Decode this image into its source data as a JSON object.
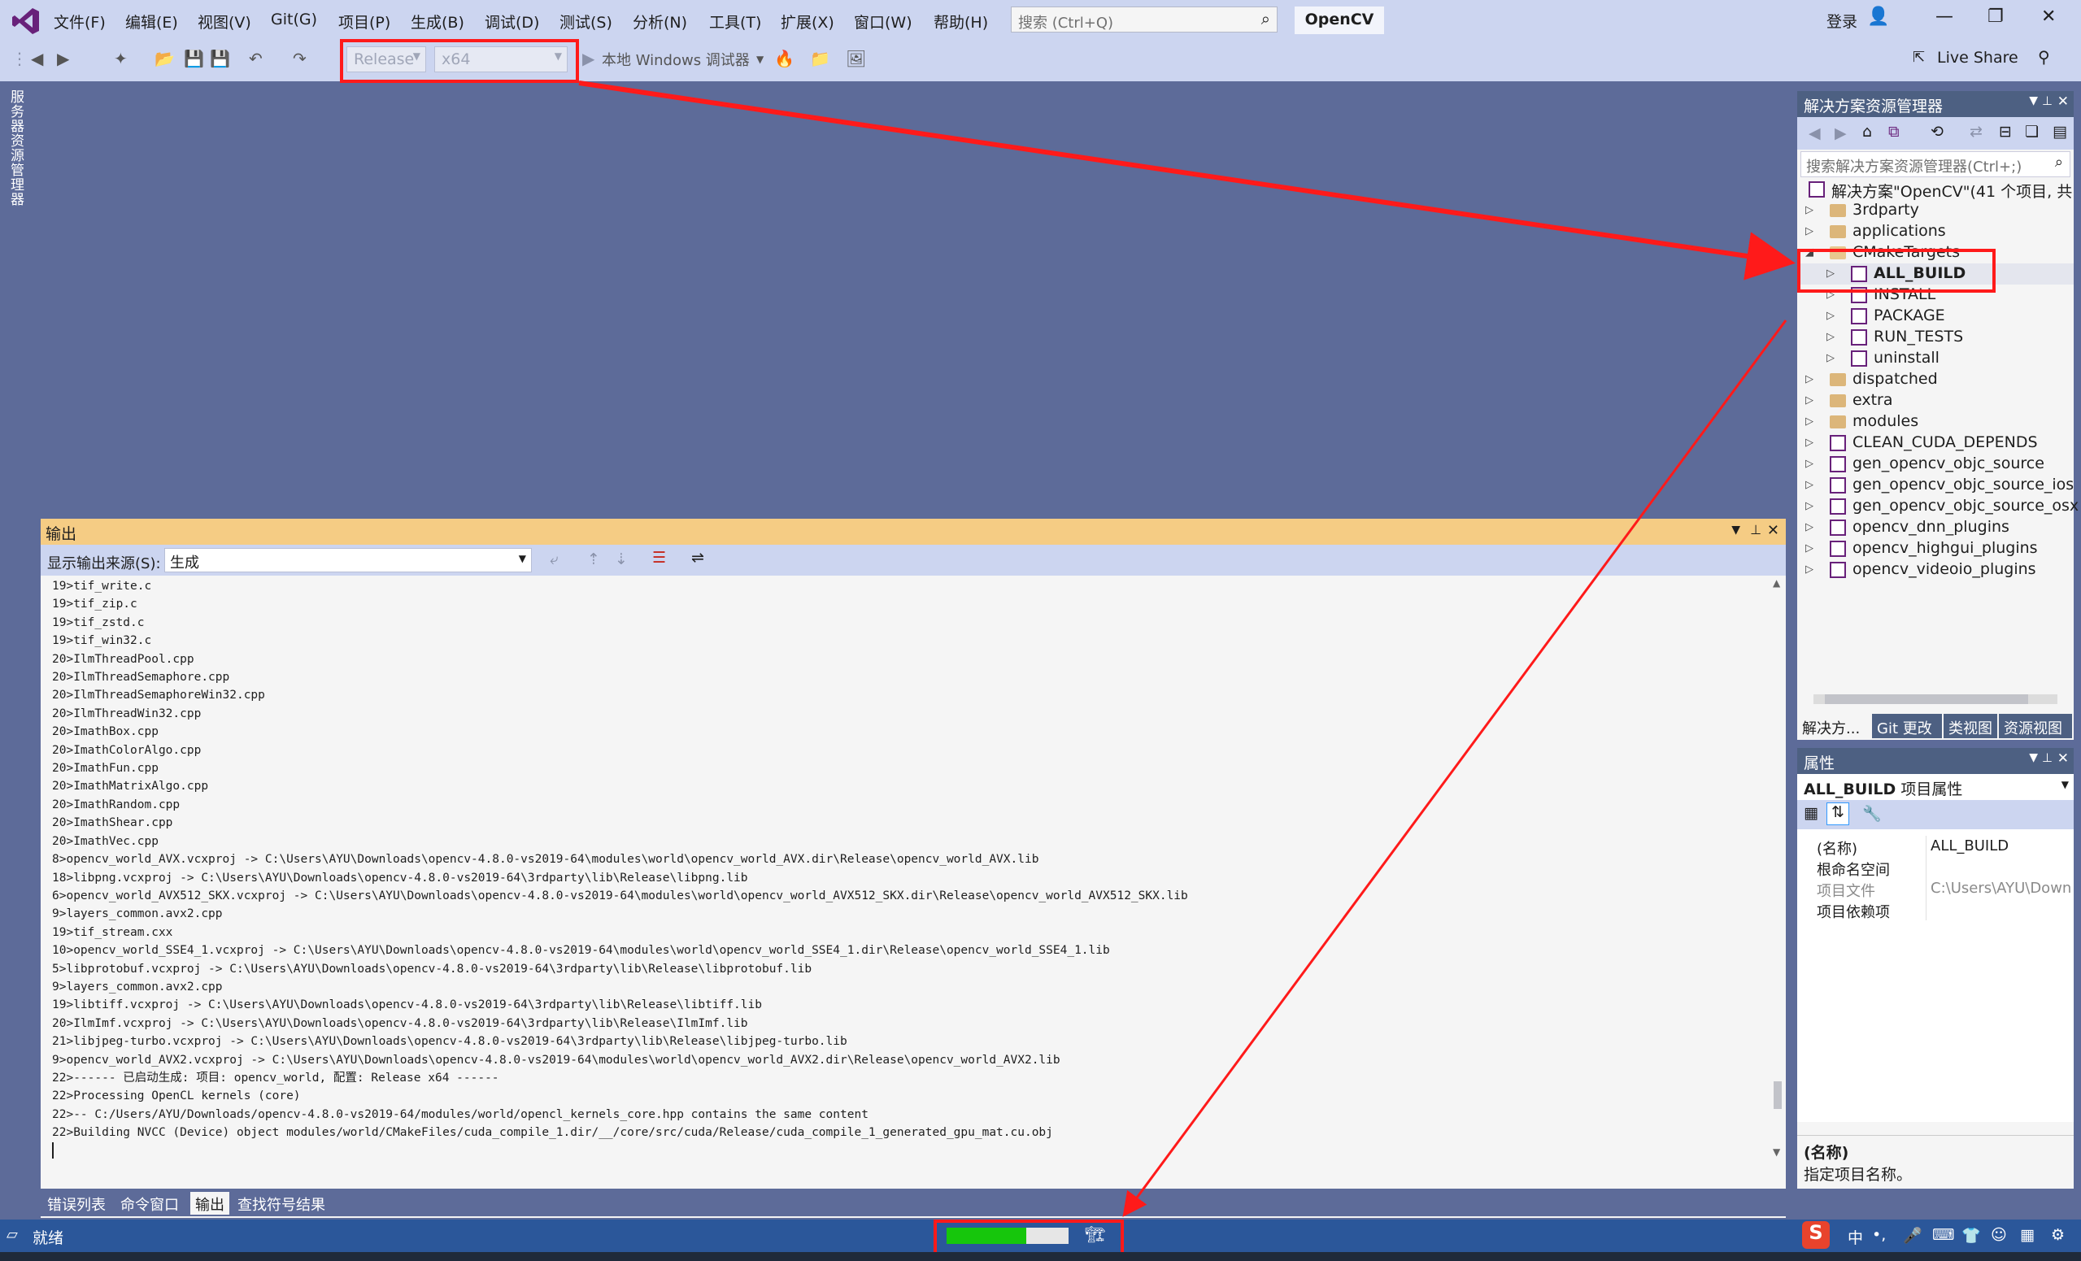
{
  "menu": [
    "文件(F)",
    "编辑(E)",
    "视图(V)",
    "Git(G)",
    "项目(P)",
    "生成(B)",
    "调试(D)",
    "测试(S)",
    "分析(N)",
    "工具(T)",
    "扩展(X)",
    "窗口(W)",
    "帮助(H)"
  ],
  "search": {
    "placeholder": "搜索 (Ctrl+Q)"
  },
  "app_name": "OpenCV",
  "login": "登录",
  "live_share": "Live Share",
  "toolbar": {
    "config": "Release",
    "platform": "x64",
    "debugger": "本地 Windows 调试器"
  },
  "left_strip": "服务器资源管理器",
  "solution_explorer": {
    "title": "解决方案资源管理器",
    "search_placeholder": "搜索解决方案资源管理器(Ctrl+;)",
    "items": [
      {
        "label": "解决方案\"OpenCV\"(41 个项目, 共",
        "kind": "solution"
      },
      {
        "label": "3rdparty",
        "kind": "folder"
      },
      {
        "label": "applications",
        "kind": "folder"
      },
      {
        "label": "CMakeTargets",
        "kind": "folder-open"
      },
      {
        "label": "ALL_BUILD",
        "kind": "project"
      },
      {
        "label": "INSTALL",
        "kind": "project"
      },
      {
        "label": "PACKAGE",
        "kind": "project"
      },
      {
        "label": "RUN_TESTS",
        "kind": "project"
      },
      {
        "label": "uninstall",
        "kind": "project"
      },
      {
        "label": "dispatched",
        "kind": "folder"
      },
      {
        "label": "extra",
        "kind": "folder"
      },
      {
        "label": "modules",
        "kind": "folder"
      },
      {
        "label": "CLEAN_CUDA_DEPENDS",
        "kind": "project"
      },
      {
        "label": "gen_opencv_objc_source",
        "kind": "project"
      },
      {
        "label": "gen_opencv_objc_source_ios",
        "kind": "project"
      },
      {
        "label": "gen_opencv_objc_source_osx",
        "kind": "project"
      },
      {
        "label": "opencv_dnn_plugins",
        "kind": "project"
      },
      {
        "label": "opencv_highgui_plugins",
        "kind": "project"
      },
      {
        "label": "opencv_videoio_plugins",
        "kind": "project"
      }
    ],
    "tabs": [
      "解决方...",
      "Git 更改",
      "类视图",
      "资源视图"
    ]
  },
  "properties": {
    "title": "属性",
    "object": "ALL_BUILD",
    "object_suffix": "项目属性",
    "rows": [
      {
        "name": "(名称)",
        "value": "ALL_BUILD"
      },
      {
        "name": "根命名空间",
        "value": ""
      },
      {
        "name": "项目文件",
        "value": "C:\\Users\\AYU\\Down"
      },
      {
        "name": "项目依赖项",
        "value": ""
      }
    ],
    "desc_title": "(名称)",
    "desc_text": "指定项目名称。"
  },
  "output": {
    "title": "输出",
    "source_label": "显示输出来源(S):",
    "source_value": "生成",
    "lines": [
      "19>tif_write.c",
      "19>tif_zip.c",
      "19>tif_zstd.c",
      "19>tif_win32.c",
      "20>IlmThreadPool.cpp",
      "20>IlmThreadSemaphore.cpp",
      "20>IlmThreadSemaphoreWin32.cpp",
      "20>IlmThreadWin32.cpp",
      "20>ImathBox.cpp",
      "20>ImathColorAlgo.cpp",
      "20>ImathFun.cpp",
      "20>ImathMatrixAlgo.cpp",
      "20>ImathRandom.cpp",
      "20>ImathShear.cpp",
      "20>ImathVec.cpp",
      "8>opencv_world_AVX.vcxproj -> C:\\Users\\AYU\\Downloads\\opencv-4.8.0-vs2019-64\\modules\\world\\opencv_world_AVX.dir\\Release\\opencv_world_AVX.lib",
      "18>libpng.vcxproj -> C:\\Users\\AYU\\Downloads\\opencv-4.8.0-vs2019-64\\3rdparty\\lib\\Release\\libpng.lib",
      "6>opencv_world_AVX512_SKX.vcxproj -> C:\\Users\\AYU\\Downloads\\opencv-4.8.0-vs2019-64\\modules\\world\\opencv_world_AVX512_SKX.dir\\Release\\opencv_world_AVX512_SKX.lib",
      "9>layers_common.avx2.cpp",
      "19>tif_stream.cxx",
      "10>opencv_world_SSE4_1.vcxproj -> C:\\Users\\AYU\\Downloads\\opencv-4.8.0-vs2019-64\\modules\\world\\opencv_world_SSE4_1.dir\\Release\\opencv_world_SSE4_1.lib",
      "5>libprotobuf.vcxproj -> C:\\Users\\AYU\\Downloads\\opencv-4.8.0-vs2019-64\\3rdparty\\lib\\Release\\libprotobuf.lib",
      "9>layers_common.avx2.cpp",
      "19>libtiff.vcxproj -> C:\\Users\\AYU\\Downloads\\opencv-4.8.0-vs2019-64\\3rdparty\\lib\\Release\\libtiff.lib",
      "20>IlmImf.vcxproj -> C:\\Users\\AYU\\Downloads\\opencv-4.8.0-vs2019-64\\3rdparty\\lib\\Release\\IlmImf.lib",
      "21>libjpeg-turbo.vcxproj -> C:\\Users\\AYU\\Downloads\\opencv-4.8.0-vs2019-64\\3rdparty\\lib\\Release\\libjpeg-turbo.lib",
      "9>opencv_world_AVX2.vcxproj -> C:\\Users\\AYU\\Downloads\\opencv-4.8.0-vs2019-64\\modules\\world\\opencv_world_AVX2.dir\\Release\\opencv_world_AVX2.lib",
      "22>------ 已启动生成: 项目: opencv_world, 配置: Release x64 ------",
      "22>Processing OpenCL kernels (core)",
      "22>-- C:/Users/AYU/Downloads/opencv-4.8.0-vs2019-64/modules/world/opencl_kernels_core.hpp contains the same content",
      "22>Building NVCC (Device) object modules/world/CMakeFiles/cuda_compile_1.dir/__/core/src/cuda/Release/cuda_compile_1_generated_gpu_mat.cu.obj"
    ]
  },
  "bottom_tabs": [
    "错误列表",
    "命令窗口",
    "输出",
    "查找符号结果"
  ],
  "status": {
    "text": "就绪",
    "progress": 0.65,
    "progress_color": "#16c60c"
  },
  "ime": {
    "label": "中"
  },
  "colors": {
    "accent": "#5d6b99",
    "annotation": "#ff1a1a",
    "output_title": "#f5cc84"
  }
}
